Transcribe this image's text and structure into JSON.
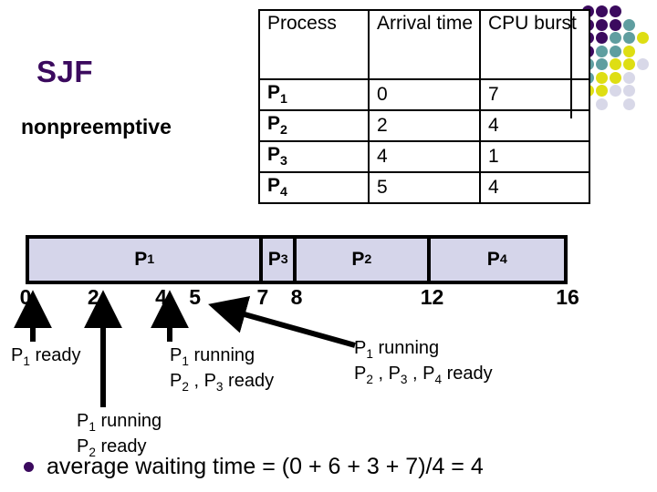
{
  "title": {
    "main": "SJF",
    "subtitle": "nonpreemptive",
    "main_color": "#3b0a5e"
  },
  "table": {
    "headers": [
      "Process",
      "Arrival time",
      "CPU burst"
    ],
    "rows": [
      {
        "process": "P",
        "process_sub": "1",
        "arrival": "0",
        "burst": "7"
      },
      {
        "process": "P",
        "process_sub": "2",
        "arrival": "2",
        "burst": "4"
      },
      {
        "process": "P",
        "process_sub": "3",
        "arrival": "4",
        "burst": "1"
      },
      {
        "process": "P",
        "process_sub": "4",
        "arrival": "5",
        "burst": "4"
      }
    ]
  },
  "gantt": {
    "fill_color": "#d5d5ea",
    "segments": [
      {
        "label": "P",
        "sub": "1",
        "start": 0,
        "end": 7
      },
      {
        "label": "P",
        "sub": "3",
        "start": 7,
        "end": 8
      },
      {
        "label": "P",
        "sub": "2",
        "start": 8,
        "end": 12
      },
      {
        "label": "P",
        "sub": "4",
        "start": 12,
        "end": 16
      }
    ],
    "ticks": [
      0,
      2,
      4,
      5,
      7,
      8,
      12,
      16
    ],
    "axis_start": 0,
    "axis_end": 16
  },
  "annotations": [
    {
      "id": "t0",
      "lines": [
        "P@1 ready"
      ],
      "at_time": 0
    },
    {
      "id": "t2",
      "lines": [
        "P@1 running",
        "P@2 ready"
      ],
      "at_time": 2
    },
    {
      "id": "t4",
      "lines": [
        "P@1 running",
        "P@2 , P@3 ready"
      ],
      "at_time": 4
    },
    {
      "id": "t5",
      "lines": [
        "P@1 running",
        "P@2 , P@3 , P@4 ready"
      ],
      "at_time": 5
    }
  ],
  "summary": {
    "bullet_color": "#3b0a5e",
    "text": "average waiting time = (0 + 6 + 3 + 7)/4 = 4"
  },
  "decor": {
    "colors": {
      "purple": "#3b0a5e",
      "teal": "#5f9ea0",
      "yellow": "#dede13",
      "lavender": "#d8d8e8"
    },
    "grid": [
      [
        "purple",
        "purple",
        "purple",
        "",
        ""
      ],
      [
        "purple",
        "purple",
        "purple",
        "teal",
        ""
      ],
      [
        "purple",
        "purple",
        "teal",
        "teal",
        "yellow"
      ],
      [
        "purple",
        "teal",
        "teal",
        "yellow",
        ""
      ],
      [
        "teal",
        "teal",
        "yellow",
        "yellow",
        "lavender"
      ],
      [
        "teal",
        "yellow",
        "yellow",
        "lavender",
        ""
      ],
      [
        "yellow",
        "yellow",
        "lavender",
        "lavender",
        ""
      ],
      [
        "",
        "lavender",
        "",
        "lavender",
        ""
      ]
    ]
  }
}
